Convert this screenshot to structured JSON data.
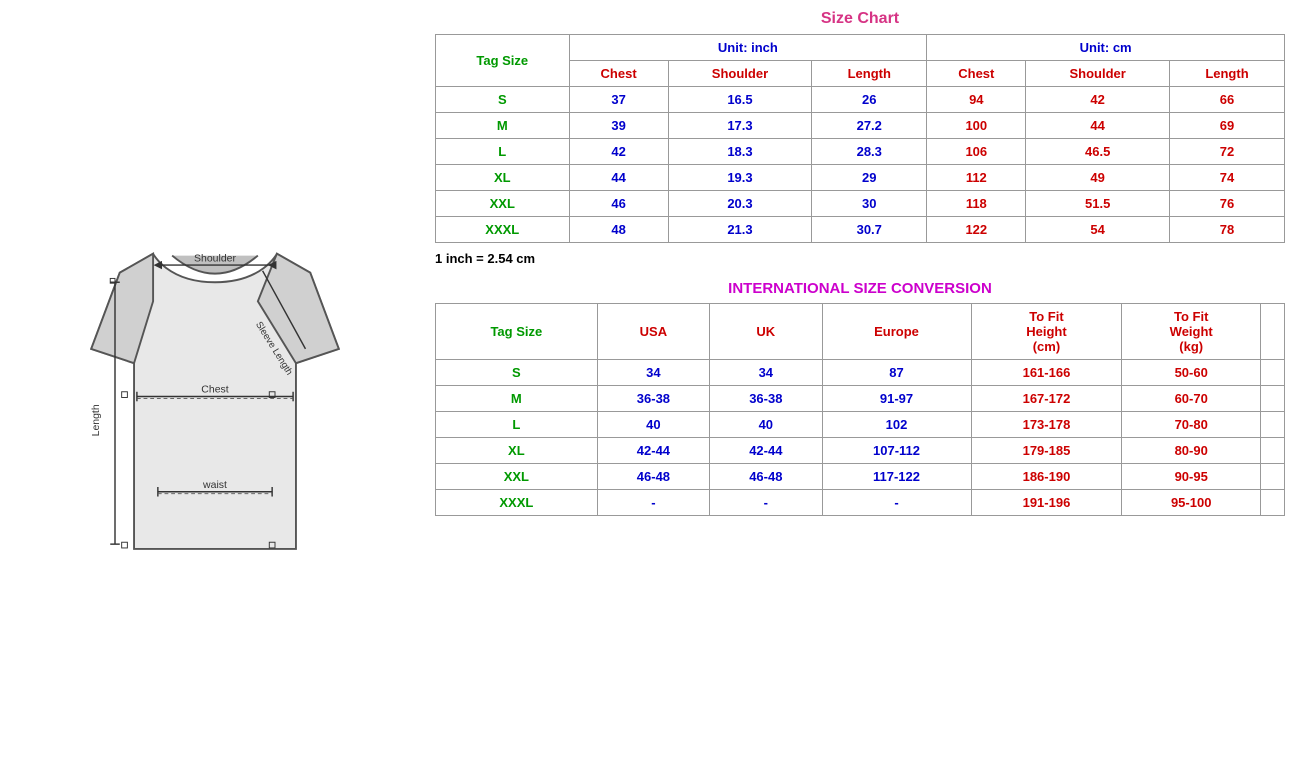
{
  "left": {
    "diagram_alt": "T-shirt size diagram"
  },
  "right": {
    "size_chart_title": "Size Chart",
    "unit_inch": "Unit: inch",
    "unit_cm": "Unit: cm",
    "tag_size_label": "Tag Size",
    "col_headers_inch": [
      "Chest",
      "Shoulder",
      "Length"
    ],
    "col_headers_cm": [
      "Chest",
      "Shoulder",
      "Length"
    ],
    "rows": [
      {
        "tag": "S",
        "chest_in": "37",
        "shoulder_in": "16.5",
        "length_in": "26",
        "chest_cm": "94",
        "shoulder_cm": "42",
        "length_cm": "66"
      },
      {
        "tag": "M",
        "chest_in": "39",
        "shoulder_in": "17.3",
        "length_in": "27.2",
        "chest_cm": "100",
        "shoulder_cm": "44",
        "length_cm": "69"
      },
      {
        "tag": "L",
        "chest_in": "42",
        "shoulder_in": "18.3",
        "length_in": "28.3",
        "chest_cm": "106",
        "shoulder_cm": "46.5",
        "length_cm": "72"
      },
      {
        "tag": "XL",
        "chest_in": "44",
        "shoulder_in": "19.3",
        "length_in": "29",
        "chest_cm": "112",
        "shoulder_cm": "49",
        "length_cm": "74"
      },
      {
        "tag": "XXL",
        "chest_in": "46",
        "shoulder_in": "20.3",
        "length_in": "30",
        "chest_cm": "118",
        "shoulder_cm": "51.5",
        "length_cm": "76"
      },
      {
        "tag": "XXXL",
        "chest_in": "48",
        "shoulder_in": "21.3",
        "length_in": "30.7",
        "chest_cm": "122",
        "shoulder_cm": "54",
        "length_cm": "78"
      }
    ],
    "inch_note": "1 inch = 2.54 cm",
    "conversion_title": "INTERNATIONAL SIZE CONVERSION",
    "conv_col_tag": "Tag Size",
    "conv_col_usa": "USA",
    "conv_col_uk": "UK",
    "conv_col_europe": "Europe",
    "conv_col_height": "To Fit Height (cm)",
    "conv_col_weight": "To Fit Weight (kg)",
    "conv_rows": [
      {
        "tag": "S",
        "usa": "34",
        "uk": "34",
        "europe": "87",
        "height": "161-166",
        "weight": "50-60"
      },
      {
        "tag": "M",
        "usa": "36-38",
        "uk": "36-38",
        "europe": "91-97",
        "height": "167-172",
        "weight": "60-70"
      },
      {
        "tag": "L",
        "usa": "40",
        "uk": "40",
        "europe": "102",
        "height": "173-178",
        "weight": "70-80"
      },
      {
        "tag": "XL",
        "usa": "42-44",
        "uk": "42-44",
        "europe": "107-112",
        "height": "179-185",
        "weight": "80-90"
      },
      {
        "tag": "XXL",
        "usa": "46-48",
        "uk": "46-48",
        "europe": "117-122",
        "height": "186-190",
        "weight": "90-95"
      },
      {
        "tag": "XXXL",
        "usa": "-",
        "uk": "-",
        "europe": "-",
        "height": "191-196",
        "weight": "95-100"
      }
    ]
  }
}
